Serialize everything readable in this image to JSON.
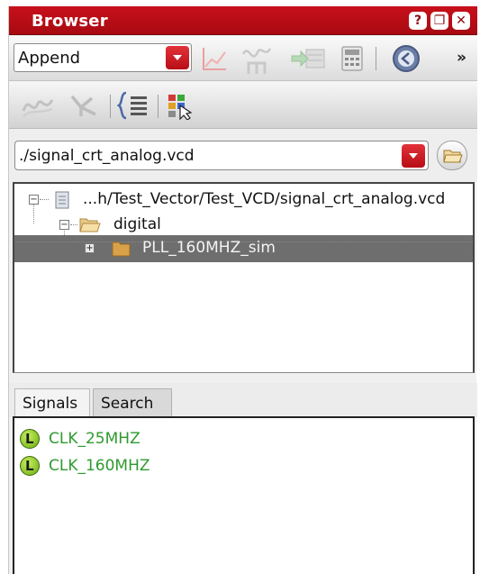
{
  "window": {
    "title": "Browser",
    "buttons": [
      "?",
      "❐",
      "✕"
    ]
  },
  "toolbar1": {
    "mode_select": {
      "value": "Append"
    },
    "overflow_label": "»",
    "icons": [
      "line-chart-icon",
      "waveform-tree-icon",
      "import-arrow-icon",
      "calculator-icon",
      "back-circle-icon"
    ]
  },
  "toolbar2": {
    "icons": [
      "analog-wave-icon",
      "branch-icon",
      "brace-list-icon",
      "color-grid-cursor-icon"
    ]
  },
  "file": {
    "path": "./signal_crt_analog.vcd"
  },
  "tree": {
    "items": [
      {
        "label": "...h/Test_Vector/Test_VCD/signal_crt_analog.vcd",
        "expander": "−"
      },
      {
        "label": "digital",
        "expander": "−"
      },
      {
        "label": "PLL_160MHZ_sim",
        "expander": "+",
        "selected": true
      }
    ]
  },
  "tabs": [
    {
      "label": "Signals",
      "active": true
    },
    {
      "label": "Search",
      "active": false
    }
  ],
  "signals": [
    {
      "label": "CLK_25MHZ",
      "badge": "L"
    },
    {
      "label": "CLK_160MHZ",
      "badge": "L"
    }
  ],
  "colors": {
    "titlebar": "#c0101a",
    "accent_red": "#d2202a",
    "signal_green": "#2f9a2f",
    "selection_gray": "#6e6e6e"
  }
}
